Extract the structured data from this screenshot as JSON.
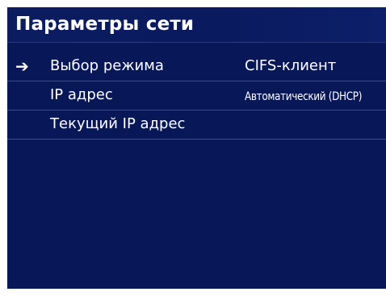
{
  "screen": {
    "title": "Параметры сети",
    "rows": [
      {
        "label": "Выбор режима",
        "value": "CIFS-клиент",
        "selected": true,
        "cursor_icon": "arrow-right-icon",
        "cursor_glyph": "➔"
      },
      {
        "label": "IP адрес",
        "value": "Автоматический (DHCP)",
        "selected": false
      },
      {
        "label": "Текущий IP адрес",
        "value": "",
        "selected": false
      }
    ]
  },
  "colors": {
    "background": "#071757",
    "text": "#ffffff",
    "divider": "#3a4c86"
  }
}
